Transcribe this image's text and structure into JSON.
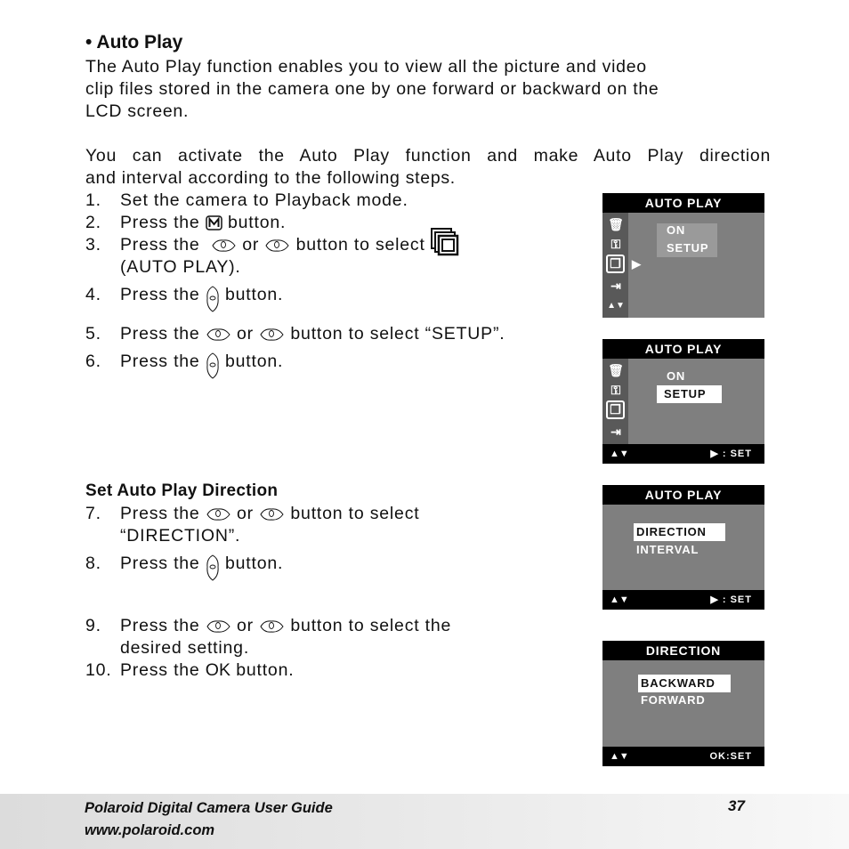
{
  "heading": "• Auto Play",
  "intro": "The Auto Play function enables you to view all the picture and video clip files stored in the camera one by one forward or backward on the LCD screen.",
  "intro_lines": [
    "The Auto Play function enables you to view all the picture and video",
    "clip files stored in the camera one by one forward or backward on the",
    "LCD screen."
  ],
  "para2_lines": [
    "You can activate the Auto Play function and make Auto Play direction",
    "and interval according to the following steps."
  ],
  "steps": [
    {
      "num": "1.",
      "text": "Set the camera to Playback mode."
    },
    {
      "num": "2.",
      "pre": "Press the",
      "icon": "menu-m-button-icon",
      "post": "button."
    },
    {
      "num": "3.",
      "pre": "Press the",
      "icon": "left-right-buttons-icon",
      "mid": "or",
      "post": "button to select",
      "cont": "(AUTO PLAY)."
    },
    {
      "num": "4.",
      "pre": "Press the",
      "icon": "right-button-icon",
      "post": "button."
    },
    {
      "num": "5.",
      "pre": "Press the",
      "icon": "up-down-buttons-icon",
      "mid": "or",
      "post": "button to select “SETUP”."
    },
    {
      "num": "6.",
      "pre": "Press the",
      "icon": "right-button-icon",
      "post": "button."
    },
    {
      "num": "7.",
      "pre": "Press the",
      "icon": "up-down-buttons-icon",
      "mid": "or",
      "post": "button to select",
      "cont": "“DIRECTION”."
    },
    {
      "num": "8.",
      "pre": "Press the",
      "icon": "right-button-icon",
      "post": "button."
    },
    {
      "num": "9.",
      "pre": "Press the",
      "icon": "up-down-buttons-icon",
      "mid": "or",
      "post": "button to select the",
      "cont": "desired setting."
    },
    {
      "num": "10.",
      "pre": "Press the",
      "ok": "OK",
      "post": "button."
    }
  ],
  "subheading": "Set Auto Play Direction",
  "screens": [
    {
      "title": "AUTO PLAY",
      "options": [
        "ON",
        "SETUP"
      ],
      "selected": null,
      "side_icons": [
        "trash-icon",
        "key-icon",
        "autoplay-icon",
        "exit-icon",
        "updown-icon"
      ]
    },
    {
      "title": "AUTO PLAY",
      "options": [
        "ON",
        "SETUP"
      ],
      "selected": "SETUP",
      "bottom_nav": "▲▼",
      "bottom_set": "▶ :  SET"
    },
    {
      "title": "AUTO PLAY",
      "options": [
        "DIRECTION",
        "INTERVAL"
      ],
      "selected": "DIRECTION",
      "bottom_nav": "▲▼",
      "bottom_set": "▶ :  SET"
    },
    {
      "title": "DIRECTION",
      "options": [
        "BACKWARD",
        "FORWARD"
      ],
      "selected": "BACKWARD",
      "bottom_nav": "▲▼",
      "bottom_set": "OK:SET"
    }
  ],
  "footer": {
    "title": "Polaroid Digital Camera User Guide",
    "url": "www.polaroid.com",
    "page": "37"
  }
}
